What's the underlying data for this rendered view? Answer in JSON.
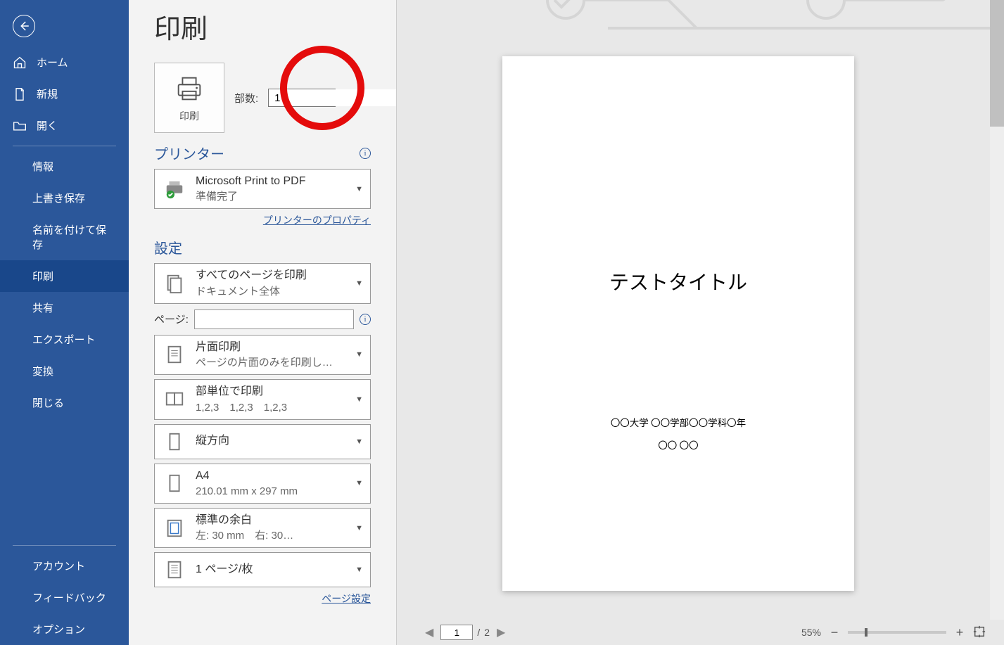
{
  "header": {
    "title": "印刷"
  },
  "nav": {
    "home": "ホーム",
    "new": "新規",
    "open": "開く",
    "info": "情報",
    "save": "上書き保存",
    "saveas": "名前を付けて保存",
    "print": "印刷",
    "share": "共有",
    "export": "エクスポート",
    "transform": "変換",
    "close": "閉じる",
    "account": "アカウント",
    "feedback": "フィードバック",
    "options": "オプション"
  },
  "printBtn": {
    "label": "印刷"
  },
  "copies": {
    "label": "部数:",
    "value": "1"
  },
  "printer": {
    "heading": "プリンター",
    "name": "Microsoft Print to PDF",
    "status": "準備完了",
    "propsLink": "プリンターのプロパティ"
  },
  "settings": {
    "heading": "設定",
    "range": {
      "t1": "すべてのページを印刷",
      "t2": "ドキュメント全体"
    },
    "pagesLabel": "ページ:",
    "duplex": {
      "t1": "片面印刷",
      "t2": "ページの片面のみを印刷し…"
    },
    "collate": {
      "t1": "部単位で印刷",
      "t2": "1,2,3　1,2,3　1,2,3"
    },
    "orient": {
      "t1": "縦方向"
    },
    "paper": {
      "t1": "A4",
      "t2": "210.01 mm x 297 mm"
    },
    "margins": {
      "t1": "標準の余白",
      "t2": "左: 30 mm　右: 30…"
    },
    "ppp": {
      "t1": "1 ページ/枚"
    },
    "pageSetupLink": "ページ設定"
  },
  "preview": {
    "docTitle": "テストタイトル",
    "line1": "〇〇大学 〇〇学部〇〇学科〇年",
    "line2": "〇〇 〇〇",
    "currentPage": "1",
    "pageSep": "/",
    "totalPages": "2",
    "zoom": "55%"
  }
}
